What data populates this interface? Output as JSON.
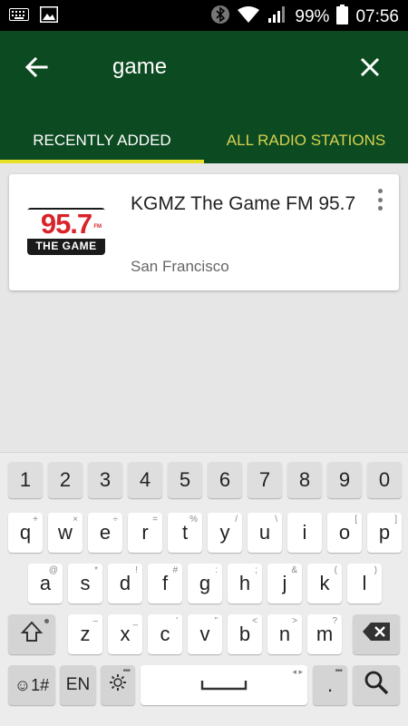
{
  "status_bar": {
    "battery": "99%",
    "time": "07:56",
    "icons": [
      "keyboard-icon",
      "image-icon",
      "bluetooth-icon",
      "wifi-icon",
      "signal-icon",
      "battery-icon"
    ]
  },
  "app_bar": {
    "search_query": "game",
    "tabs": [
      {
        "label": "RECENTLY ADDED",
        "active": true
      },
      {
        "label": "ALL RADIO STATIONS",
        "active": false
      }
    ],
    "colors": {
      "background": "#0c4a21",
      "indicator": "#e7e025",
      "inactive_tab": "#d7d24f"
    }
  },
  "results": [
    {
      "name": "KGMZ The Game FM 95.7",
      "location": "San Francisco",
      "logo": {
        "number": "95.7",
        "fm": "FM",
        "tagline": "THE GAME"
      }
    }
  ],
  "keyboard": {
    "number_row": [
      "1",
      "2",
      "3",
      "4",
      "5",
      "6",
      "7",
      "8",
      "9",
      "0"
    ],
    "row1": [
      {
        "k": "q",
        "s": "+"
      },
      {
        "k": "w",
        "s": "×"
      },
      {
        "k": "e",
        "s": "÷"
      },
      {
        "k": "r",
        "s": "="
      },
      {
        "k": "t",
        "s": "%"
      },
      {
        "k": "y",
        "s": "/"
      },
      {
        "k": "u",
        "s": "\\"
      },
      {
        "k": "i",
        "s": ""
      },
      {
        "k": "o",
        "s": "["
      },
      {
        "k": "p",
        "s": "]"
      }
    ],
    "row2": [
      {
        "k": "a",
        "s": "@"
      },
      {
        "k": "s",
        "s": "*"
      },
      {
        "k": "d",
        "s": "!"
      },
      {
        "k": "f",
        "s": "#"
      },
      {
        "k": "g",
        "s": ":"
      },
      {
        "k": "h",
        "s": ";"
      },
      {
        "k": "j",
        "s": "&"
      },
      {
        "k": "k",
        "s": "("
      },
      {
        "k": "l",
        "s": ")"
      }
    ],
    "row3": [
      {
        "k": "z",
        "s": "–"
      },
      {
        "k": "x",
        "s": "_"
      },
      {
        "k": "c",
        "s": "'"
      },
      {
        "k": "v",
        "s": "\""
      },
      {
        "k": "b",
        "s": "<"
      },
      {
        "k": "n",
        "s": ">"
      },
      {
        "k": "m",
        "s": "?"
      }
    ],
    "bottom_row": {
      "emoji_label": "☺1#",
      "lang_label": "EN",
      "period": "."
    }
  }
}
